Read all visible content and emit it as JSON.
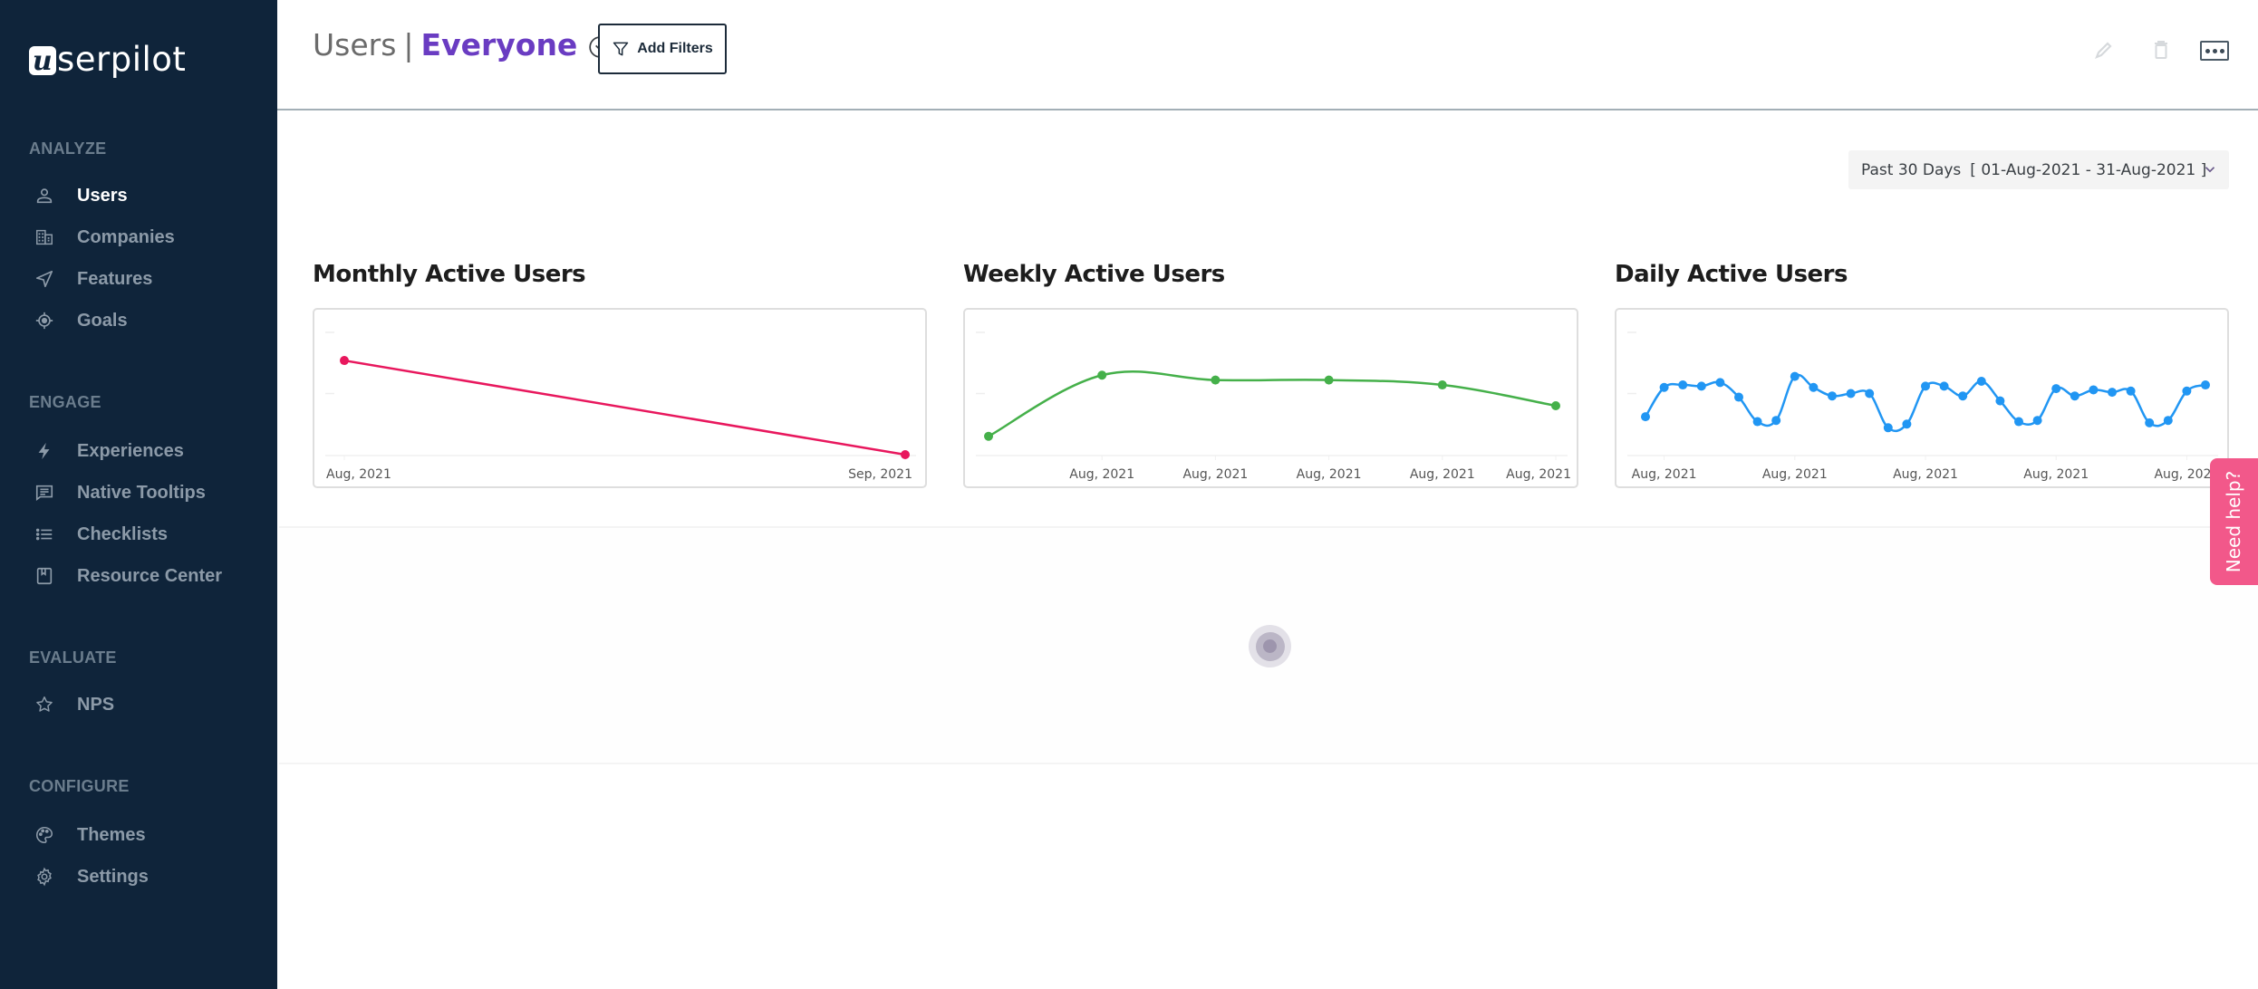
{
  "brand": {
    "logo_letter": "u",
    "logo_rest": "serpilot"
  },
  "sidebar": {
    "sections": [
      {
        "label": "ANALYZE",
        "items": [
          {
            "label": "Users",
            "icon": "user-icon",
            "active": true
          },
          {
            "label": "Companies",
            "icon": "building-icon",
            "active": false
          },
          {
            "label": "Features",
            "icon": "send-icon",
            "active": false
          },
          {
            "label": "Goals",
            "icon": "target-icon",
            "active": false
          }
        ]
      },
      {
        "label": "ENGAGE",
        "items": [
          {
            "label": "Experiences",
            "icon": "lightning-icon",
            "active": false
          },
          {
            "label": "Native Tooltips",
            "icon": "message-icon",
            "active": false
          },
          {
            "label": "Checklists",
            "icon": "list-icon",
            "active": false
          },
          {
            "label": "Resource Center",
            "icon": "bookmark-box-icon",
            "active": false
          }
        ]
      },
      {
        "label": "EVALUATE",
        "items": [
          {
            "label": "NPS",
            "icon": "star-icon",
            "active": false
          }
        ]
      },
      {
        "label": "CONFIGURE",
        "items": [
          {
            "label": "Themes",
            "icon": "palette-icon",
            "active": false
          },
          {
            "label": "Settings",
            "icon": "gear-icon",
            "active": false
          }
        ]
      }
    ]
  },
  "header": {
    "title": "Users",
    "separator": "|",
    "segment": "Everyone",
    "add_filters_label": "Add Filters",
    "actions": [
      "edit-icon",
      "trash-icon",
      "more-icon"
    ]
  },
  "date_range": {
    "preset": "Past 30 Days",
    "range": "[ 01-Aug-2021 - 31-Aug-2021 ]"
  },
  "need_help_label": "Need help?",
  "colors": {
    "sidebar_bg": "#0f243a",
    "segment": "#6a3cc2",
    "monthly": "#e8175d",
    "weekly": "#45b04a",
    "daily": "#2196f3",
    "need_help": "#f2588a"
  },
  "chart_data": [
    {
      "type": "line",
      "title": "Monthly Active Users",
      "xlabel": "",
      "ylabel": "",
      "x": [
        "Aug, 2021",
        "Sep, 2021"
      ],
      "tick_labels": [
        "Aug, 2021",
        "Sep, 2021"
      ],
      "values": [
        0.77,
        0.0
      ],
      "ylim": [
        0,
        1
      ],
      "grid": true,
      "color": "#e8175d",
      "note": "y-axis values unlabeled; relative to axis max"
    },
    {
      "type": "line",
      "title": "Weekly Active Users",
      "xlabel": "",
      "ylabel": "",
      "x": [
        0,
        1,
        2,
        3,
        4,
        5
      ],
      "tick_labels": [
        "Aug, 2021",
        "Aug, 2021",
        "Aug, 2021",
        "Aug, 2021",
        "Aug, 2021"
      ],
      "tick_positions": [
        1,
        2,
        3,
        4,
        5
      ],
      "values": [
        0.15,
        0.65,
        0.61,
        0.61,
        0.57,
        0.4
      ],
      "ylim": [
        0,
        1
      ],
      "grid": true,
      "color": "#45b04a",
      "smooth": true
    },
    {
      "type": "line",
      "title": "Daily Active Users",
      "xlabel": "",
      "ylabel": "",
      "x": [
        1,
        2,
        3,
        4,
        5,
        6,
        7,
        8,
        9,
        10,
        11,
        12,
        13,
        14,
        15,
        16,
        17,
        18,
        19,
        20,
        21,
        22,
        23,
        24,
        25,
        26,
        27,
        28,
        29,
        30,
        31
      ],
      "tick_labels": [
        "Aug, 2021",
        "Aug, 2021",
        "Aug, 2021",
        "Aug, 2021",
        "Aug, 2021"
      ],
      "tick_positions": [
        2,
        9,
        16,
        23,
        30
      ],
      "values": [
        0.31,
        0.55,
        0.57,
        0.56,
        0.59,
        0.47,
        0.27,
        0.28,
        0.64,
        0.55,
        0.48,
        0.5,
        0.5,
        0.22,
        0.25,
        0.56,
        0.56,
        0.48,
        0.6,
        0.44,
        0.27,
        0.28,
        0.54,
        0.48,
        0.53,
        0.51,
        0.52,
        0.26,
        0.28,
        0.52,
        0.57
      ],
      "ylim": [
        0,
        1
      ],
      "grid": true,
      "color": "#2196f3",
      "smooth": true
    }
  ]
}
